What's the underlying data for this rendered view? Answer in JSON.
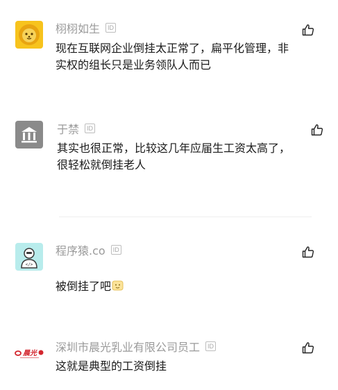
{
  "id_badge_label": "ID",
  "comments": [
    {
      "username": "栩栩如生",
      "text": "现在互联网企业倒挂太正常了，扁平化管理，非\n实权的组长只是业务领队人而已",
      "avatar_icon": "lion-icon"
    },
    {
      "username": "于禁",
      "text": "其实也很正常，比较这几年应届生工资太高了，\n很轻松就倒挂老人",
      "avatar_icon": "bank-icon"
    },
    {
      "username": "程序猿.co",
      "text": "被倒挂了吧",
      "emoji": "smile-emoji",
      "avatar_icon": "programmer-icon"
    },
    {
      "username": "深圳市晨光乳业有限公司员工",
      "text": "这就是典型的工资倒挂",
      "avatar_icon": "company-logo",
      "avatar_logo_text": "晨光"
    }
  ],
  "like_icon": "thumbs-up-icon",
  "colors": {
    "username": "#9a9a9a",
    "text": "#1a1a1a",
    "lion_avatar_bg": "#f7c31d",
    "bank_avatar_bg": "#8a8a8a",
    "programmer_avatar_bg": "#b8ecec",
    "logo_red": "#d3262e"
  }
}
